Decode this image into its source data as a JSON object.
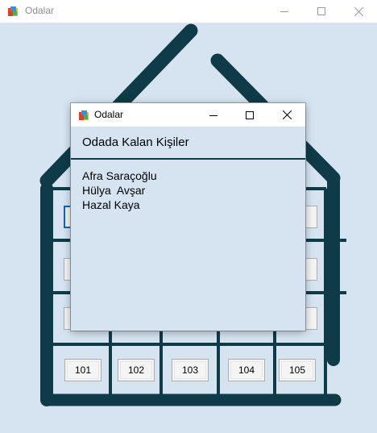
{
  "outer_window": {
    "title": "Odalar"
  },
  "rooms": [
    {
      "label": "101"
    },
    {
      "label": "102"
    },
    {
      "label": "103"
    },
    {
      "label": "104"
    },
    {
      "label": "105"
    }
  ],
  "dialog": {
    "title": "Odalar",
    "header": "Odada Kalan Kişiler",
    "occupants": [
      "Afra Saraçoğlu",
      "Hülya  Avşar",
      "Hazal Kaya"
    ]
  },
  "colors": {
    "house_stroke": "#0e3b47",
    "background": "#d6e4f2",
    "focus_border": "#0a64c8"
  }
}
